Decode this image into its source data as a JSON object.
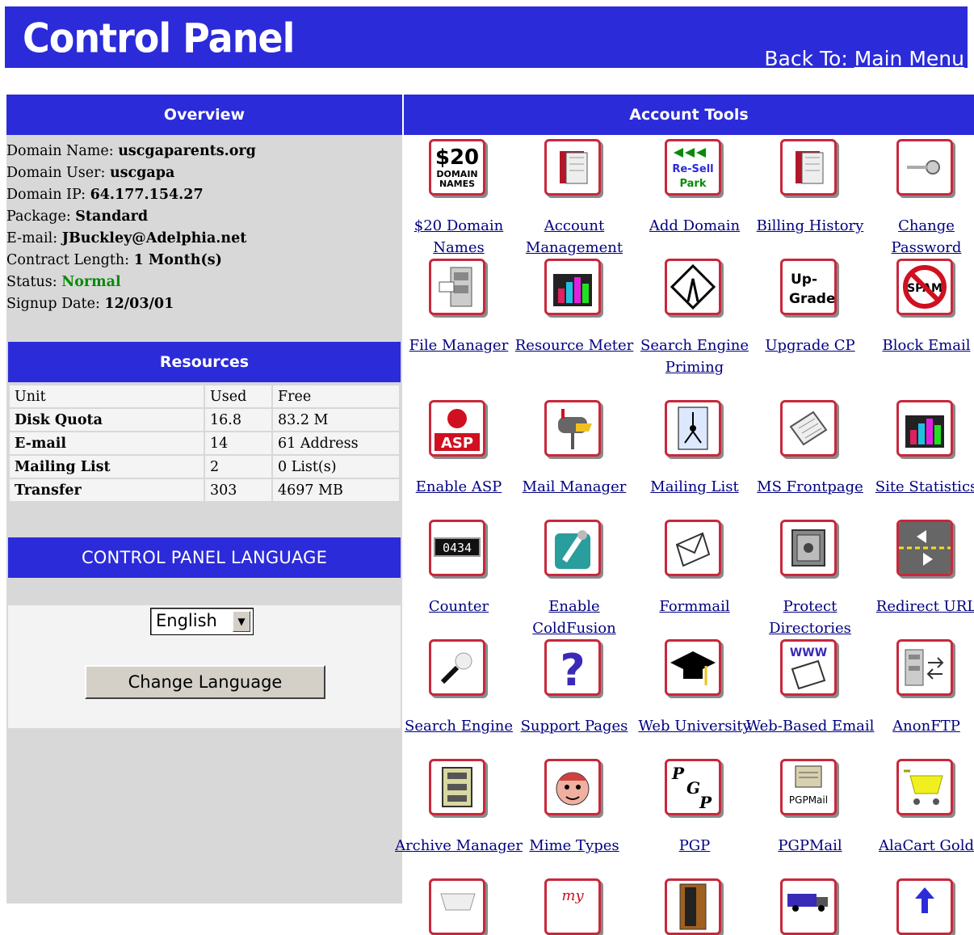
{
  "header": {
    "title": "Control Panel",
    "back_to_prefix": "Back To:",
    "back_to_link": "Main Menu"
  },
  "overview": {
    "heading": "Overview",
    "domain_name_label": "Domain Name:",
    "domain_name": "uscgaparents.org",
    "domain_user_label": "Domain User:",
    "domain_user": "uscgapa",
    "domain_ip_label": "Domain IP:",
    "domain_ip": "64.177.154.27",
    "package_label": "Package:",
    "package": "Standard",
    "email_label": "E-mail:",
    "email": "JBuckley@Adelphia.net",
    "contract_label": "Contract Length:",
    "contract": "1 Month(s)",
    "status_label": "Status:",
    "status": "Normal",
    "signup_label": "Signup Date:",
    "signup": "12/03/01"
  },
  "resources": {
    "heading": "Resources",
    "columns": [
      "Unit",
      "Used",
      "Free"
    ],
    "rows": [
      {
        "unit": "Disk Quota",
        "used": "16.8",
        "free": "83.2 M"
      },
      {
        "unit": "E-mail",
        "used": "14",
        "free": "61 Address"
      },
      {
        "unit": "Mailing List",
        "used": "2",
        "free": "0 List(s)"
      },
      {
        "unit": "Transfer",
        "used": "303",
        "free": "4697 MB"
      }
    ]
  },
  "language": {
    "heading": "CONTROL PANEL LANGUAGE",
    "selected": "English",
    "button": "Change Language"
  },
  "account_tools": {
    "heading": "Account Tools",
    "items": [
      {
        "label": "$20 Domain Names",
        "icon": "domain-names-icon"
      },
      {
        "label": "Account Management",
        "icon": "book-icon"
      },
      {
        "label": "Add Domain",
        "icon": "resell-park-icon"
      },
      {
        "label": "Billing History",
        "icon": "book-icon"
      },
      {
        "label": "Change Password",
        "icon": "key-icon"
      },
      {
        "label": "File Manager",
        "icon": "file-cabinet-icon"
      },
      {
        "label": "Resource Meter",
        "icon": "bar-chart-icon"
      },
      {
        "label": "Search Engine Priming",
        "icon": "road-sign-icon"
      },
      {
        "label": "Upgrade CP",
        "icon": "upgrade-icon"
      },
      {
        "label": "Block Email",
        "icon": "no-spam-icon"
      },
      {
        "label": "Enable ASP",
        "icon": "asp-icon"
      },
      {
        "label": "Mail Manager",
        "icon": "mailbox-icon"
      },
      {
        "label": "Mailing List",
        "icon": "mailing-list-icon"
      },
      {
        "label": "MS Frontpage",
        "icon": "newspaper-icon"
      },
      {
        "label": "Site Statistics",
        "icon": "bar-chart-icon"
      },
      {
        "label": "Counter",
        "icon": "counter-icon"
      },
      {
        "label": "Enable ColdFusion",
        "icon": "coldfusion-icon"
      },
      {
        "label": "Formmail",
        "icon": "envelope-icon"
      },
      {
        "label": "Protect Directories",
        "icon": "safe-icon"
      },
      {
        "label": "Redirect URL",
        "icon": "redirect-icon"
      },
      {
        "label": "Search Engine",
        "icon": "magnifier-icon"
      },
      {
        "label": "Support Pages",
        "icon": "question-icon"
      },
      {
        "label": "Web University",
        "icon": "graduation-cap-icon"
      },
      {
        "label": "Web-Based Email",
        "icon": "www-mail-icon"
      },
      {
        "label": "AnonFTP",
        "icon": "ftp-icon"
      },
      {
        "label": "Archive Manager",
        "icon": "archive-icon"
      },
      {
        "label": "Mime Types",
        "icon": "face-icon"
      },
      {
        "label": "PGP",
        "icon": "pgp-icon"
      },
      {
        "label": "PGPMail",
        "icon": "pgpmail-icon"
      },
      {
        "label": "AlaCart Gold",
        "icon": "shopping-cart-icon"
      },
      {
        "label": "",
        "icon": "cart-icon"
      },
      {
        "label": "",
        "icon": "my-icon"
      },
      {
        "label": "",
        "icon": "door-icon"
      },
      {
        "label": "",
        "icon": "truck-icon"
      },
      {
        "label": "",
        "icon": "upload-icon"
      }
    ]
  },
  "icon_text": {
    "domain_price": "$20",
    "domain_word1": "DOMAIN",
    "domain_word2": "NAMES",
    "resell": "Re-Sell",
    "park": "Park",
    "upgrade1": "Up-",
    "upgrade2": "Grade",
    "spam": "SPAM",
    "asp": "ASP",
    "counter": "0434",
    "www": "WWW",
    "pgpmail": "PGPMail",
    "my": "my"
  },
  "colors": {
    "header_blue": "#2b2bd9",
    "icon_border_red": "#c8283c",
    "link_navy": "#000080",
    "status_green": "#0a8a0a"
  }
}
